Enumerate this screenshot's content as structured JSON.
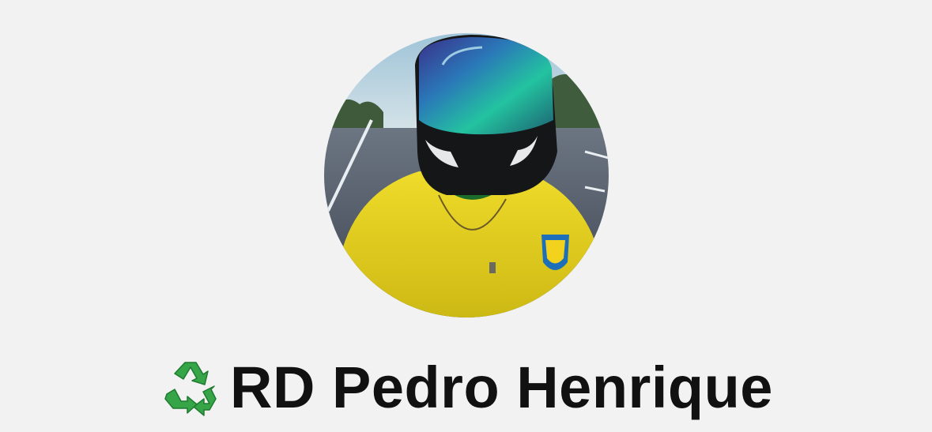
{
  "profile": {
    "display_name": "RD Pedro Henrique",
    "name_prefix_icon": "recycle-icon",
    "avatar_icon": "profile-photo-motorcyclist"
  },
  "colors": {
    "background": "#f2f2f2",
    "name_text": "#111111",
    "recycle_badge": "#35a548",
    "jersey_yellow": "#e8d21e",
    "jersey_collar": "#1b6b2a"
  }
}
